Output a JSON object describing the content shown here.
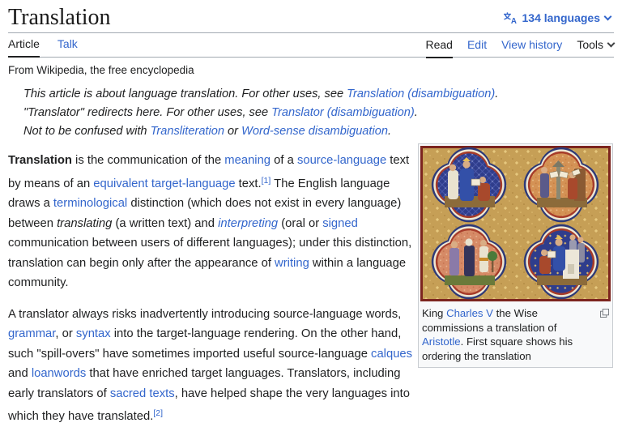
{
  "page": {
    "background": "#ffffff",
    "link_color": "#3366cc",
    "text_color": "#202122",
    "divider_color": "#a2a9b1"
  },
  "header": {
    "title": "Translation",
    "languages_button": {
      "label": "134 languages",
      "icon": "translate-icon",
      "dropdown_icon": "chevron-down-icon"
    },
    "tabs_left": [
      {
        "label": "Article",
        "active": true
      },
      {
        "label": "Talk",
        "active": false
      }
    ],
    "tabs_right": [
      {
        "label": "Read",
        "active": true
      },
      {
        "label": "Edit",
        "active": false
      },
      {
        "label": "View history",
        "active": false
      },
      {
        "label": "Tools",
        "active": false,
        "dropdown_icon": "chevron-down-icon"
      }
    ],
    "tagline": "From Wikipedia, the free encyclopedia"
  },
  "hatnotes": [
    {
      "segments": [
        {
          "t": "This article is about language translation. For other uses, see ",
          "s": "plain"
        },
        {
          "t": "Translation (disambiguation)",
          "s": "link"
        },
        {
          "t": ".",
          "s": "plain"
        }
      ]
    },
    {
      "segments": [
        {
          "t": "\"Translator\" redirects here. For other uses, see ",
          "s": "plain"
        },
        {
          "t": "Translator (disambiguation)",
          "s": "link"
        },
        {
          "t": ".",
          "s": "plain"
        }
      ]
    },
    {
      "segments": [
        {
          "t": "Not to be confused with ",
          "s": "plain"
        },
        {
          "t": "Transliteration",
          "s": "link"
        },
        {
          "t": " or ",
          "s": "plain"
        },
        {
          "t": "Word-sense disambiguation",
          "s": "link"
        },
        {
          "t": ".",
          "s": "plain"
        }
      ]
    }
  ],
  "article": {
    "paragraphs": [
      {
        "segments": [
          {
            "t": "Translation",
            "s": "bold"
          },
          {
            "t": " is the communication of the ",
            "s": "plain"
          },
          {
            "t": "meaning",
            "s": "link"
          },
          {
            "t": " of a ",
            "s": "plain"
          },
          {
            "t": "source-language",
            "s": "link"
          },
          {
            "t": " text by means of an ",
            "s": "plain"
          },
          {
            "t": "equivalent",
            "s": "link"
          },
          {
            "t": " ",
            "s": "plain"
          },
          {
            "t": "target-language",
            "s": "link"
          },
          {
            "t": " text.",
            "s": "plain"
          },
          {
            "t": "[1]",
            "s": "sup-link"
          },
          {
            "t": " The English language draws a ",
            "s": "plain"
          },
          {
            "t": "terminological",
            "s": "link"
          },
          {
            "t": " distinction (which does not exist in every language) between ",
            "s": "plain"
          },
          {
            "t": "translating",
            "s": "italic"
          },
          {
            "t": " (a written text) and ",
            "s": "plain"
          },
          {
            "t": "interpreting",
            "s": "italic-link"
          },
          {
            "t": " (oral or ",
            "s": "plain"
          },
          {
            "t": "signed",
            "s": "link"
          },
          {
            "t": " communication between users of different languages); under this distinction, translation can begin only after the appearance of ",
            "s": "plain"
          },
          {
            "t": "writing",
            "s": "link"
          },
          {
            "t": " within a language community.",
            "s": "plain"
          }
        ]
      },
      {
        "segments": [
          {
            "t": "A translator always risks inadvertently introducing source-language words, ",
            "s": "plain"
          },
          {
            "t": "grammar",
            "s": "link"
          },
          {
            "t": ", or ",
            "s": "plain"
          },
          {
            "t": "syntax",
            "s": "link"
          },
          {
            "t": " into the target-language rendering. On the other hand, such \"spill-overs\" have sometimes imported useful source-language ",
            "s": "plain"
          },
          {
            "t": "calques",
            "s": "link"
          },
          {
            "t": " and ",
            "s": "plain"
          },
          {
            "t": "loanwords",
            "s": "link"
          },
          {
            "t": " that have enriched target languages. Translators, including early translators of ",
            "s": "plain"
          },
          {
            "t": "sacred texts",
            "s": "link"
          },
          {
            "t": ", have helped shape the very languages into which they have translated.",
            "s": "plain"
          },
          {
            "t": "[2]",
            "s": "sup-link"
          }
        ]
      }
    ]
  },
  "thumbnail": {
    "image_description": "medieval-illuminated-manuscript-four-quatrefoil-scenes",
    "expand_icon": "expand-icon",
    "caption": {
      "segments": [
        {
          "t": "King ",
          "s": "plain"
        },
        {
          "t": "Charles V",
          "s": "link"
        },
        {
          "t": " the Wise commissions a translation of ",
          "s": "plain"
        },
        {
          "t": "Aristotle",
          "s": "link"
        },
        {
          "t": ". First square shows his ordering the translation",
          "s": "plain"
        }
      ]
    }
  }
}
